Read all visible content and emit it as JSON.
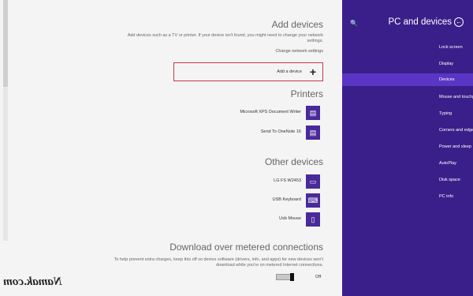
{
  "content": {
    "add_devices": {
      "title": "Add devices",
      "desc": "Add devices such as a TV or printer. If your device isn't found, you might need to change your network settings.",
      "change_network": "Change network settings",
      "add_button_label": "Add a device",
      "add_button_icon": "+"
    },
    "printers": {
      "title": "Printers",
      "items": [
        {
          "label": "Microsoft XPS Document Writer",
          "icon": "printer-icon"
        },
        {
          "label": "Send To OneNote 16",
          "icon": "printer-icon"
        }
      ]
    },
    "other_devices": {
      "title": "Other devices",
      "items": [
        {
          "label": "LG FS W2453",
          "icon": "monitor-icon"
        },
        {
          "label": "USB Keyboard",
          "icon": "keyboard-icon"
        },
        {
          "label": "Usb Mouse",
          "icon": "mouse-icon"
        }
      ]
    },
    "metered": {
      "title": "Download over metered connections",
      "desc": "To help prevent extra charges, keep this off so device software (drivers, info, and apps) for new devices won't download while you're on metered Internet connections.",
      "toggle_state": "Off"
    }
  },
  "sidebar": {
    "title": "PC and devices",
    "back_icon": "←",
    "search_icon": "🔍",
    "items": [
      {
        "label": "Lock screen",
        "active": false
      },
      {
        "label": "Display",
        "active": false
      },
      {
        "label": "Devices",
        "active": true
      },
      {
        "label": "Mouse and touchpad",
        "active": false
      },
      {
        "label": "Typing",
        "active": false
      },
      {
        "label": "Corners and edges",
        "active": false
      },
      {
        "label": "Power and sleep",
        "active": false
      },
      {
        "label": "AutoPlay",
        "active": false
      },
      {
        "label": "Disk space",
        "active": false
      },
      {
        "label": "PC info",
        "active": false
      }
    ]
  },
  "watermark": "Namak.com",
  "colors": {
    "sidebar_bg": "#3a1f8a",
    "active_item": "#5b36c4",
    "focus_border": "#c23a50",
    "device_icon_bg": "#4a2a9a"
  }
}
